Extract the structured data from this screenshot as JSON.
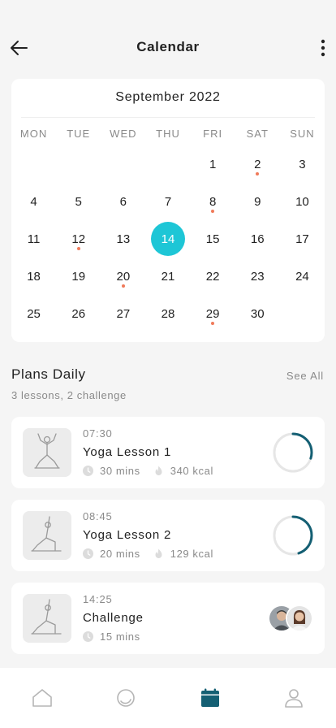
{
  "header": {
    "title": "Calendar"
  },
  "calendar": {
    "month_label": "September 2022",
    "weekdays": [
      "MON",
      "TUE",
      "WED",
      "THU",
      "FRI",
      "SAT",
      "SUN"
    ],
    "weeks": [
      [
        "",
        "",
        "",
        "",
        "1",
        "2",
        "3"
      ],
      [
        "4",
        "5",
        "6",
        "7",
        "8",
        "9",
        "10"
      ],
      [
        "11",
        "12",
        "13",
        "14",
        "15",
        "16",
        "17"
      ],
      [
        "18",
        "19",
        "20",
        "21",
        "22",
        "23",
        "24"
      ],
      [
        "25",
        "26",
        "27",
        "28",
        "29",
        "30",
        ""
      ]
    ],
    "selected_day": "14",
    "marked_days": [
      "2",
      "8",
      "12",
      "20",
      "29"
    ],
    "accent_color": "#1ec6d6",
    "marker_color": "#f07a5a"
  },
  "plans": {
    "title": "Plans Daily",
    "see_all": "See All",
    "subtitle": "3 lessons, 2 challenge",
    "items": [
      {
        "time": "07:30",
        "name": "Yoga Lesson 1",
        "duration": "30 mins",
        "calories": "340 kcal",
        "progress": 0.3,
        "thumb_icon": "yoga-arms-up-pose-icon"
      },
      {
        "time": "08:45",
        "name": "Yoga Lesson 2",
        "duration": "20 mins",
        "calories": "129 kcal",
        "progress": 0.45,
        "thumb_icon": "yoga-warrior-pose-icon"
      },
      {
        "time": "14:25",
        "name": "Challenge",
        "duration": "15 mins",
        "thumb_icon": "yoga-warrior-pose-icon"
      }
    ],
    "progress_color": "#145f73"
  },
  "nav": {
    "items": [
      {
        "name": "home",
        "icon": "home-icon",
        "active": false
      },
      {
        "name": "activity",
        "icon": "ring-icon",
        "active": false
      },
      {
        "name": "calendar",
        "icon": "calendar-icon",
        "active": true
      },
      {
        "name": "profile",
        "icon": "user-icon",
        "active": false
      }
    ],
    "active_color": "#145f73"
  }
}
